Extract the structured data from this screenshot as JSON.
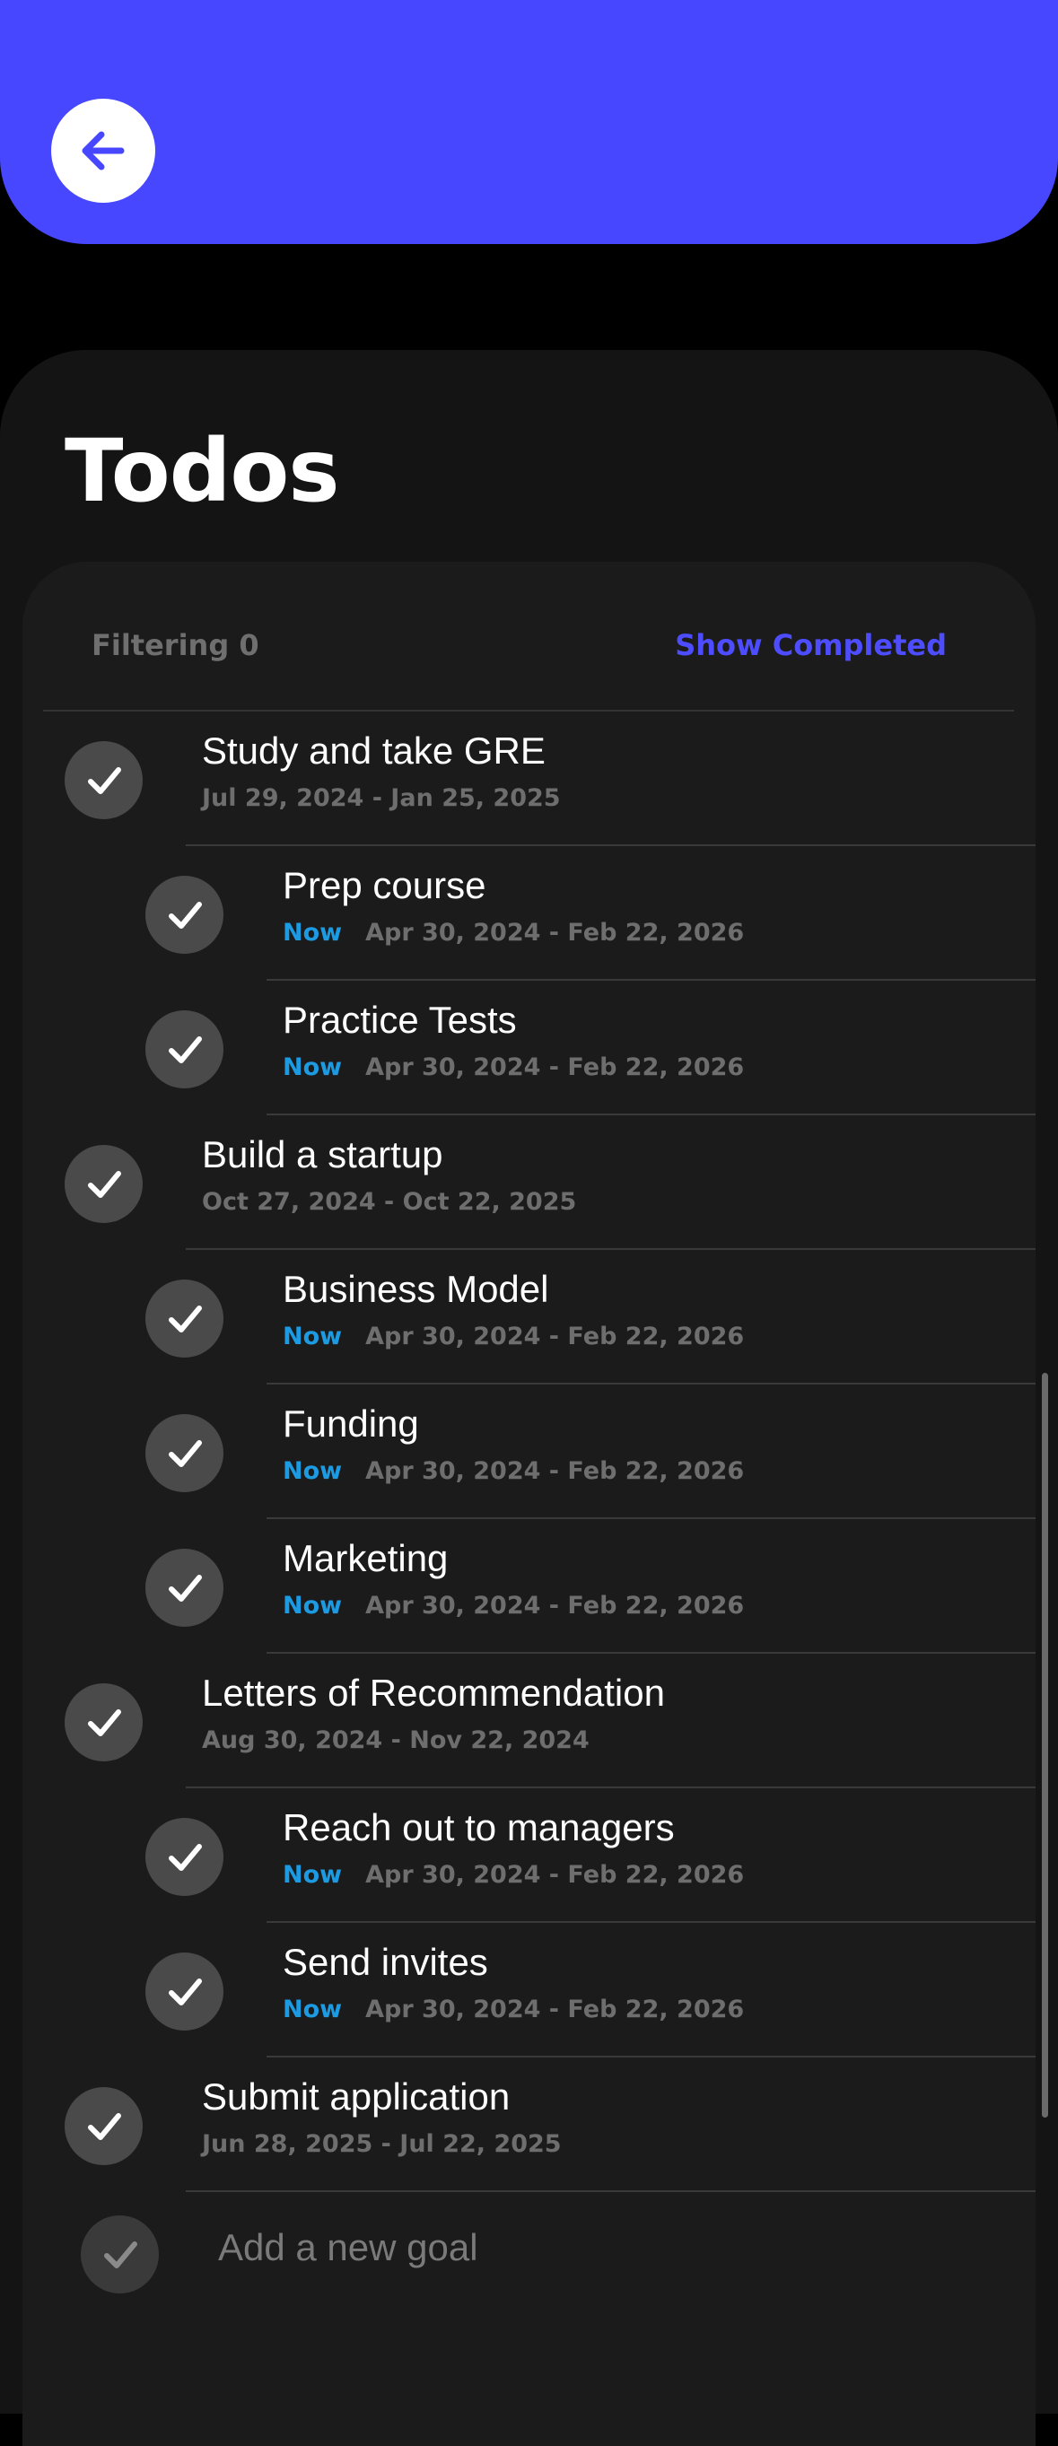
{
  "header": {
    "color": "#4747FF",
    "back_icon": "arrow-left-icon"
  },
  "page": {
    "title": "Todos"
  },
  "filter": {
    "label": "Filtering 0",
    "show_completed": "Show Completed"
  },
  "items": [
    {
      "level": "top",
      "title": "Study and take GRE",
      "now": "",
      "dates": "Jul 29, 2024 - Jan 25, 2025"
    },
    {
      "level": "sub",
      "title": "Prep course",
      "now": "Now",
      "dates": "Apr 30, 2024 - Feb 22, 2026"
    },
    {
      "level": "sub",
      "title": "Practice Tests",
      "now": "Now",
      "dates": "Apr 30, 2024 - Feb 22, 2026"
    },
    {
      "level": "top",
      "title": "Build a startup",
      "now": "",
      "dates": "Oct 27, 2024 - Oct 22, 2025"
    },
    {
      "level": "sub",
      "title": "Business Model",
      "now": "Now",
      "dates": "Apr 30, 2024 - Feb 22, 2026"
    },
    {
      "level": "sub",
      "title": "Funding",
      "now": "Now",
      "dates": "Apr 30, 2024 - Feb 22, 2026"
    },
    {
      "level": "sub",
      "title": "Marketing",
      "now": "Now",
      "dates": "Apr 30, 2024 - Feb 22, 2026"
    },
    {
      "level": "top",
      "title": "Letters of Recommendation",
      "now": "",
      "dates": "Aug 30, 2024 - Nov 22, 2024"
    },
    {
      "level": "sub",
      "title": "Reach out to managers",
      "now": "Now",
      "dates": "Apr 30, 2024 - Feb 22, 2026"
    },
    {
      "level": "sub",
      "title": "Send invites",
      "now": "Now",
      "dates": "Apr 30, 2024 - Feb 22, 2026"
    },
    {
      "level": "top",
      "title": "Submit application",
      "now": "",
      "dates": "Jun 28, 2025 - Jul 22, 2025"
    }
  ],
  "add_goal": {
    "placeholder": "Add a new goal"
  },
  "colors": {
    "accent": "#4D4DFF",
    "now": "#1C9BE3",
    "check_bg": "#4A4A4A"
  }
}
